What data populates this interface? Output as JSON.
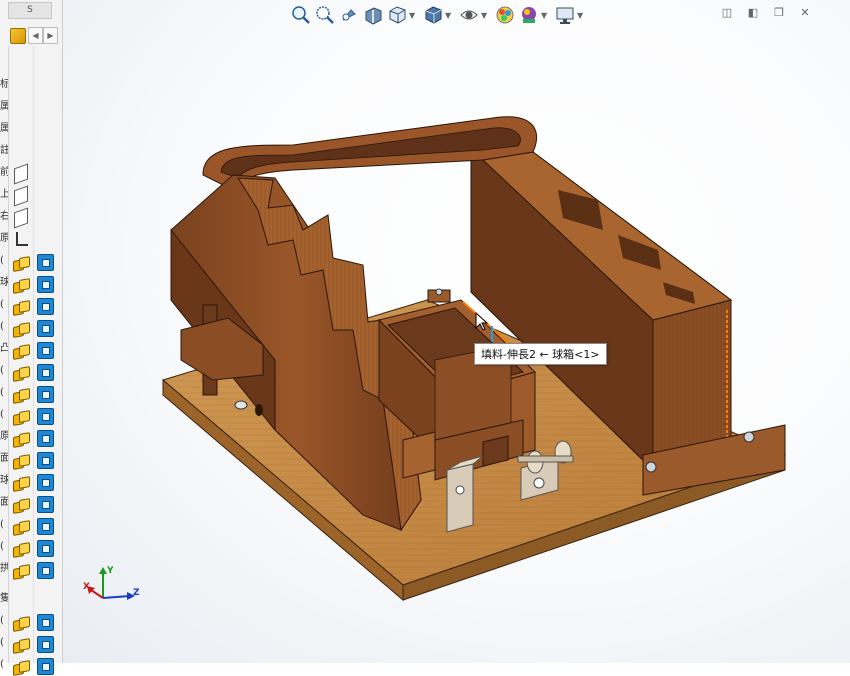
{
  "tree": {
    "tab_label": "S",
    "nav_left": "◀",
    "nav_right": "▶",
    "rows": [
      {
        "glyph": "标",
        "icon": "none"
      },
      {
        "glyph": "属",
        "icon": "none"
      },
      {
        "glyph": "属",
        "icon": "none"
      },
      {
        "glyph": "註",
        "icon": "none"
      },
      {
        "glyph": "前",
        "icon": "plane"
      },
      {
        "glyph": "上",
        "icon": "plane"
      },
      {
        "glyph": "右",
        "icon": "plane"
      },
      {
        "glyph": "原",
        "icon": "origin"
      },
      {
        "glyph": "(",
        "icon": "part"
      },
      {
        "glyph": "球",
        "icon": "part"
      },
      {
        "glyph": "(",
        "icon": "part"
      },
      {
        "glyph": "(",
        "icon": "part"
      },
      {
        "glyph": "凸",
        "icon": "part"
      },
      {
        "glyph": "(",
        "icon": "part"
      },
      {
        "glyph": "(",
        "icon": "part"
      },
      {
        "glyph": "(",
        "icon": "part"
      },
      {
        "glyph": "原",
        "icon": "part"
      },
      {
        "glyph": "面",
        "icon": "part"
      },
      {
        "glyph": "球",
        "icon": "part"
      },
      {
        "glyph": "面",
        "icon": "part"
      },
      {
        "glyph": "(",
        "icon": "part"
      },
      {
        "glyph": "(",
        "icon": "part"
      },
      {
        "glyph": "拱",
        "icon": "part"
      },
      {
        "glyph": "隻",
        "icon": "none"
      },
      {
        "glyph": "(",
        "icon": "part"
      },
      {
        "glyph": "(",
        "icon": "part"
      },
      {
        "glyph": "(",
        "icon": "part"
      }
    ]
  },
  "hud": {
    "icons": [
      "zoom-to-fit-icon",
      "zoom-to-area-icon",
      "previous-view-icon",
      "section-view-icon",
      "view-orientation-icon",
      "display-style-icon",
      "hide-show-items-icon",
      "edit-appearance-icon",
      "apply-scene-icon",
      "view-settings-icon"
    ]
  },
  "window": {
    "restore_left": "◫",
    "restore_right": "◧",
    "restore": "❐",
    "close": "✕"
  },
  "tooltip": {
    "text": "填料-伸長2 ← 球箱<1>"
  },
  "triad": {
    "x_label": "X",
    "y_label": "Y",
    "z_label": "Z"
  },
  "colors": {
    "wood_dark": "#6b3a1c",
    "wood_mid": "#8a4d24",
    "wood_light": "#a9632f",
    "base_top": "#c38742",
    "base_edge": "#8c5a25",
    "metal": "#d8cbb7",
    "highlight": "#ff7a00"
  }
}
